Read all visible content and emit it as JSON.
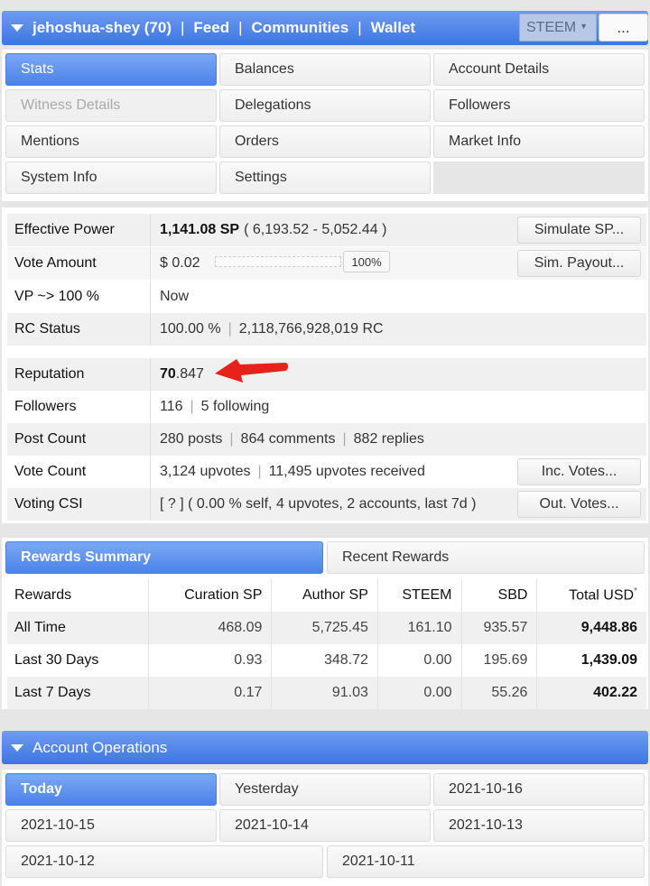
{
  "header": {
    "account": "jehoshua-shey (70)",
    "nav": [
      "Feed",
      "Communities",
      "Wallet"
    ],
    "separator": "|",
    "currency_select": "STEEM",
    "currency_caret": "▼",
    "more_label": "..."
  },
  "tabs": {
    "stats": "Stats",
    "balances": "Balances",
    "account_details": "Account Details",
    "witness_details": "Witness Details",
    "delegations": "Delegations",
    "followers": "Followers",
    "mentions": "Mentions",
    "orders": "Orders",
    "market_info": "Market Info",
    "system_info": "System Info",
    "settings": "Settings"
  },
  "stats": {
    "effective_power": {
      "label": "Effective Power",
      "value_bold": "1,141.08 SP",
      "value_rest": "( 6,193.52 - 5,052.44 )",
      "button": "Simulate SP..."
    },
    "vote_amount": {
      "label": "Vote Amount",
      "value": "$ 0.02",
      "percent": "100%",
      "button": "Sim. Payout..."
    },
    "vp": {
      "label": "VP ~> 100 %",
      "value": "Now"
    },
    "rc": {
      "label": "RC Status",
      "pct": "100.00 %",
      "rc": "2,118,766,928,019 RC"
    },
    "reputation": {
      "label": "Reputation",
      "int": "70",
      "dec": ".847"
    },
    "followers": {
      "label": "Followers",
      "count": "116",
      "following": "5 following"
    },
    "post_count": {
      "label": "Post Count",
      "posts": "280 posts",
      "comments": "864 comments",
      "replies": "882 replies"
    },
    "vote_count": {
      "label": "Vote Count",
      "upvotes": "3,124 upvotes",
      "received": "11,495 upvotes received",
      "button": "Inc. Votes..."
    },
    "voting_csi": {
      "label": "Voting CSI",
      "value": "[ ? ] ( 0.00 % self, 4 upvotes, 2 accounts, last 7d )",
      "button": "Out. Votes..."
    }
  },
  "rewards_tabs": {
    "summary": "Rewards Summary",
    "recent": "Recent Rewards"
  },
  "rewards_table": {
    "headers": [
      "Rewards",
      "Curation SP",
      "Author SP",
      "STEEM",
      "SBD",
      "Total USD"
    ],
    "asterisk": "*",
    "rows": [
      [
        "All Time",
        "468.09",
        "5,725.45",
        "161.10",
        "935.57",
        "9,448.86"
      ],
      [
        "Last 30 Days",
        "0.93",
        "348.72",
        "0.00",
        "195.69",
        "1,439.09"
      ],
      [
        "Last 7 Days",
        "0.17",
        "91.03",
        "0.00",
        "55.26",
        "402.22"
      ]
    ]
  },
  "operations": {
    "title": "Account Operations",
    "days": [
      "Today",
      "Yesterday",
      "2021-10-16",
      "2021-10-15",
      "2021-10-14",
      "2021-10-13",
      "2021-10-12",
      "2021-10-11"
    ]
  },
  "colors": {
    "accent": "#4b82ea",
    "annotation": "#e8221b"
  }
}
